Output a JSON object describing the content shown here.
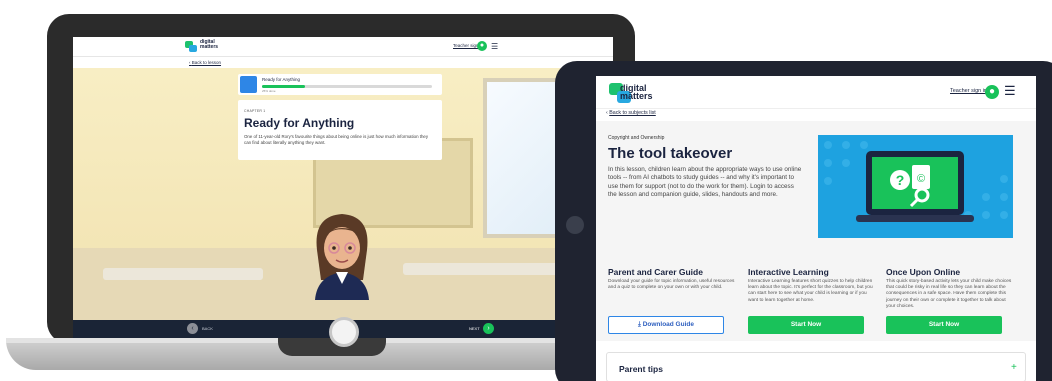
{
  "laptop": {
    "logo": {
      "line1": "digital",
      "line2": "matters"
    },
    "teacher_signin": "Teacher sign in",
    "back_link": "Back to lesson",
    "progress": {
      "title": "Ready for Anything",
      "percent_label": "25% done",
      "fraction": 0.25
    },
    "chapter": "CHAPTER 1",
    "title": "Ready for Anything",
    "body": "One of 11-year-old Rory's favourite things about being online is just how much information they can find about literally anything they want.",
    "footer": {
      "back_label": "BACK",
      "next_label": "NEXT"
    }
  },
  "tablet": {
    "logo": {
      "line1": "digital",
      "line2": "matters"
    },
    "teacher_signin": "Teacher sign in",
    "back_link": "Back to subjects list",
    "overline": "Copyright and Ownership",
    "title": "The tool takeover",
    "description": "In this lesson, children learn about the appropriate ways to use online tools -- from AI chatbots to study guides -- and why it's important to use them for support (not to do the work for them). Login to access the lesson and companion guide, slides, handouts and more.",
    "columns": [
      {
        "heading": "Parent and Carer Guide",
        "text": "Download your guide for topic information, useful resources and a quiz to complete on your own or with your child.",
        "button": "Download Guide"
      },
      {
        "heading": "Interactive Learning",
        "text": "Interactive Learning features short quizzes to help children learn about the topic. It's perfect for the classroom, but you can start here to see what your child is learning or if you want to learn together at home.",
        "button": "Start Now"
      },
      {
        "heading": "Once Upon Online",
        "text": "This quick story-based activity lets your child make choices that could be risky in real life so they can learn about the consequences in a safe space. Have them complete this journey on their own or complete it together to talk about your choices.",
        "button": "Start Now"
      }
    ],
    "tips_label": "Parent tips"
  },
  "colors": {
    "brand_green": "#19c25a",
    "brand_blue": "#28a8e0",
    "navy": "#1b2440",
    "hero_blue": "#1ea2e0"
  }
}
